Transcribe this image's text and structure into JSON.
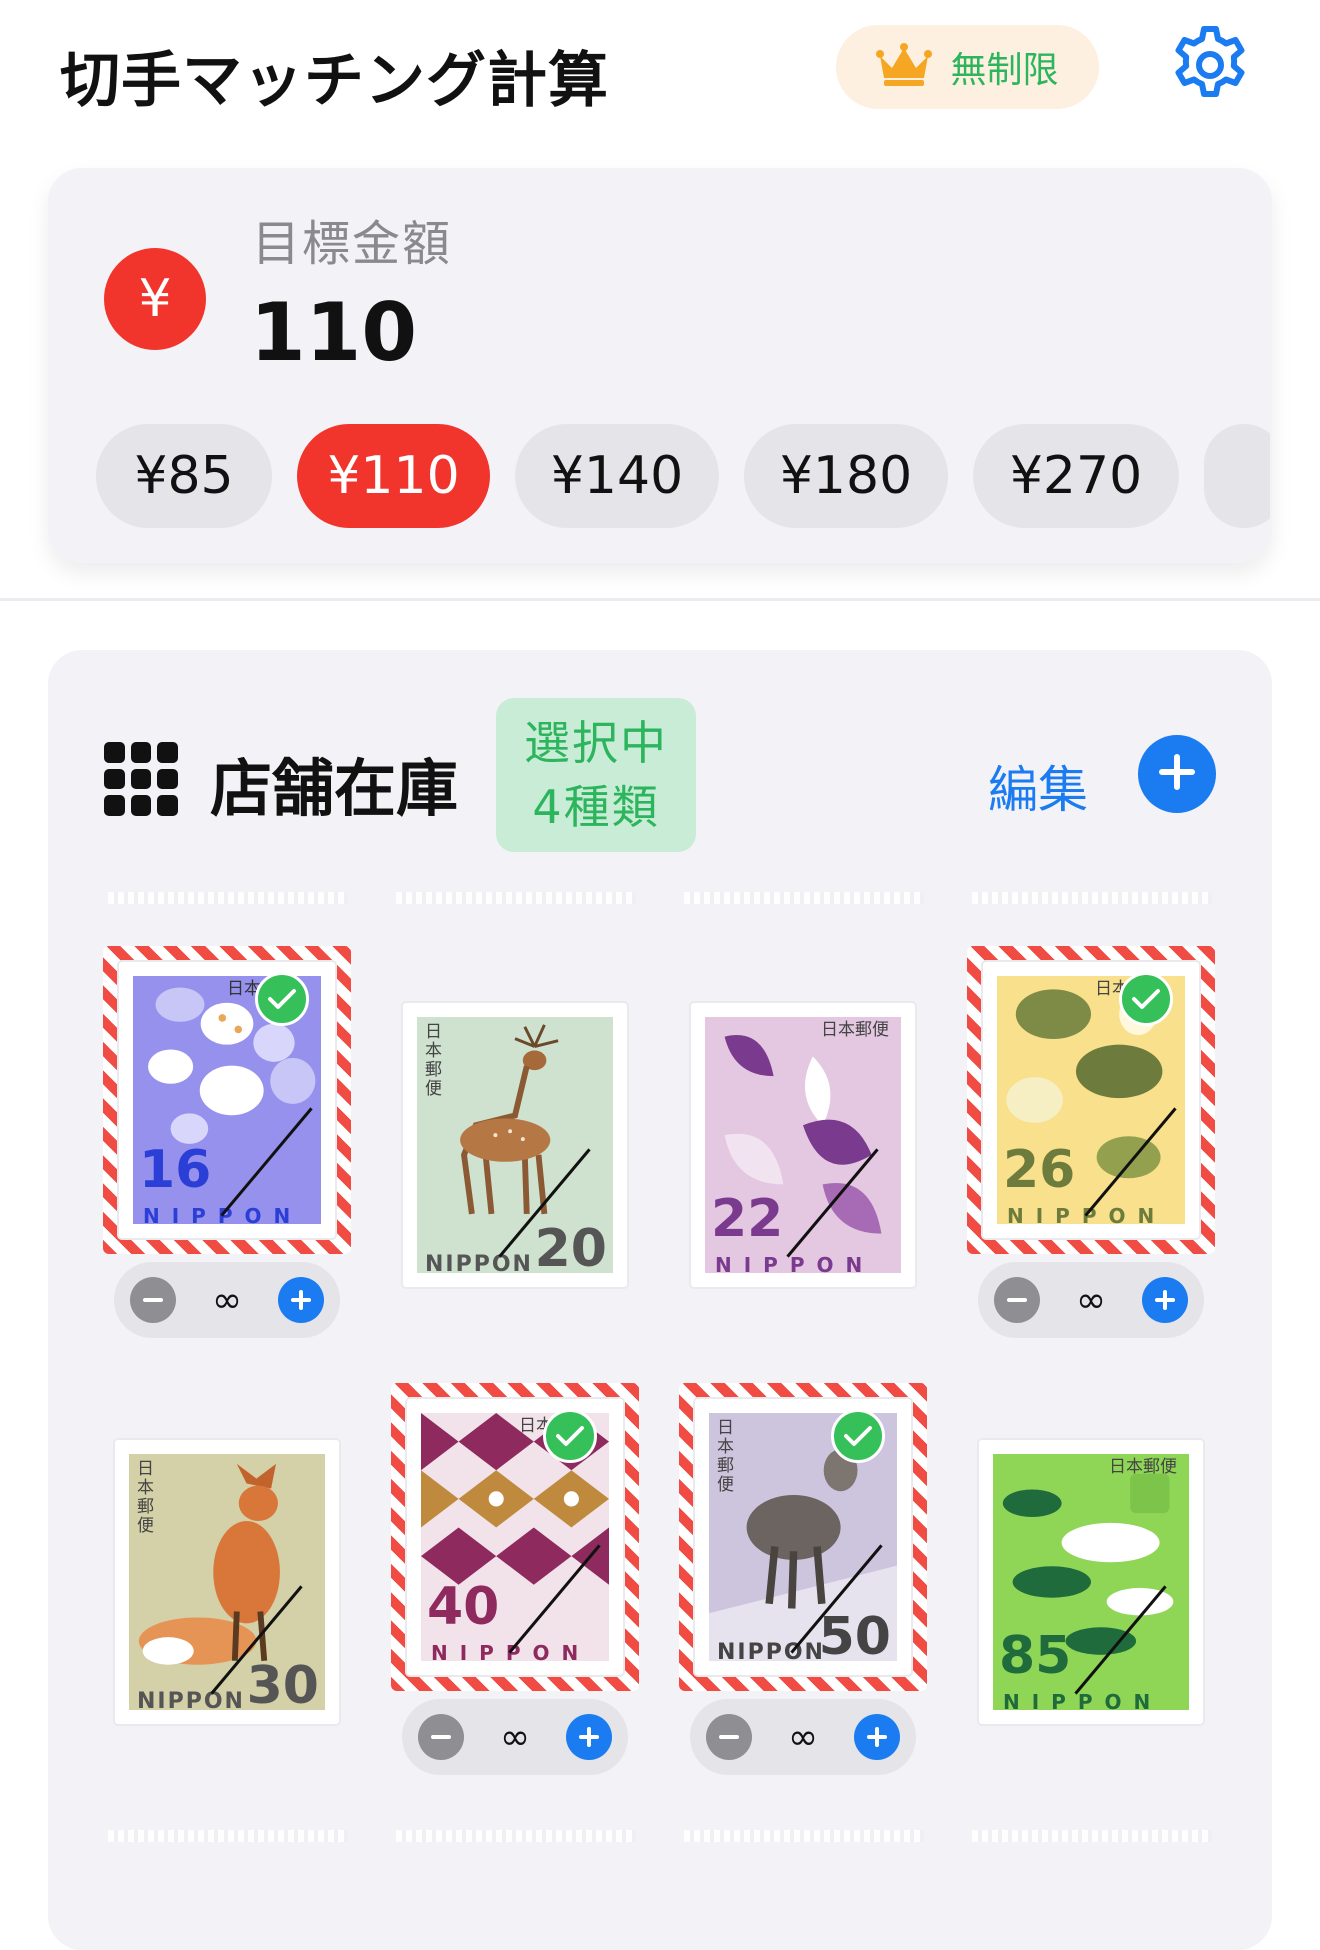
{
  "header": {
    "title": "切手マッチング計算",
    "premium_label": "無制限"
  },
  "target": {
    "label": "目標金額",
    "value": "110",
    "currency_symbol": "¥",
    "presets": [
      {
        "label": "¥85",
        "active": false
      },
      {
        "label": "¥110",
        "active": true
      },
      {
        "label": "¥140",
        "active": false
      },
      {
        "label": "¥180",
        "active": false
      },
      {
        "label": "¥270",
        "active": false
      }
    ]
  },
  "inventory": {
    "title": "店舗在庫",
    "selection_line1": "選択中",
    "selection_line2": "4種類",
    "edit_label": "編集",
    "stamps": [
      {
        "denomination": "16",
        "country": "NIPPON",
        "subject": "shells",
        "selected": true,
        "quantity": "∞"
      },
      {
        "denomination": "20",
        "country": "NIPPON",
        "subject": "deer",
        "selected": false,
        "quantity": "∞"
      },
      {
        "denomination": "22",
        "country": "NIPPON",
        "subject": "leaves",
        "selected": false,
        "quantity": "∞"
      },
      {
        "denomination": "26",
        "country": "NIPPON",
        "subject": "birds",
        "selected": true,
        "quantity": "∞"
      },
      {
        "denomination": "30",
        "country": "NIPPON",
        "subject": "fox",
        "selected": false,
        "quantity": "∞"
      },
      {
        "denomination": "40",
        "country": "NIPPON",
        "subject": "pattern",
        "selected": true,
        "quantity": "∞"
      },
      {
        "denomination": "50",
        "country": "NIPPON",
        "subject": "serow",
        "selected": true,
        "quantity": "∞"
      },
      {
        "denomination": "85",
        "country": "NIPPON",
        "subject": "pine",
        "selected": false,
        "quantity": "∞"
      }
    ],
    "stamp_kanji": "日本郵便"
  },
  "colors": {
    "accent_red": "#f2352c",
    "accent_blue": "#1a7cf0",
    "accent_green": "#2db55d",
    "premium_bg": "#fdf0e0"
  }
}
